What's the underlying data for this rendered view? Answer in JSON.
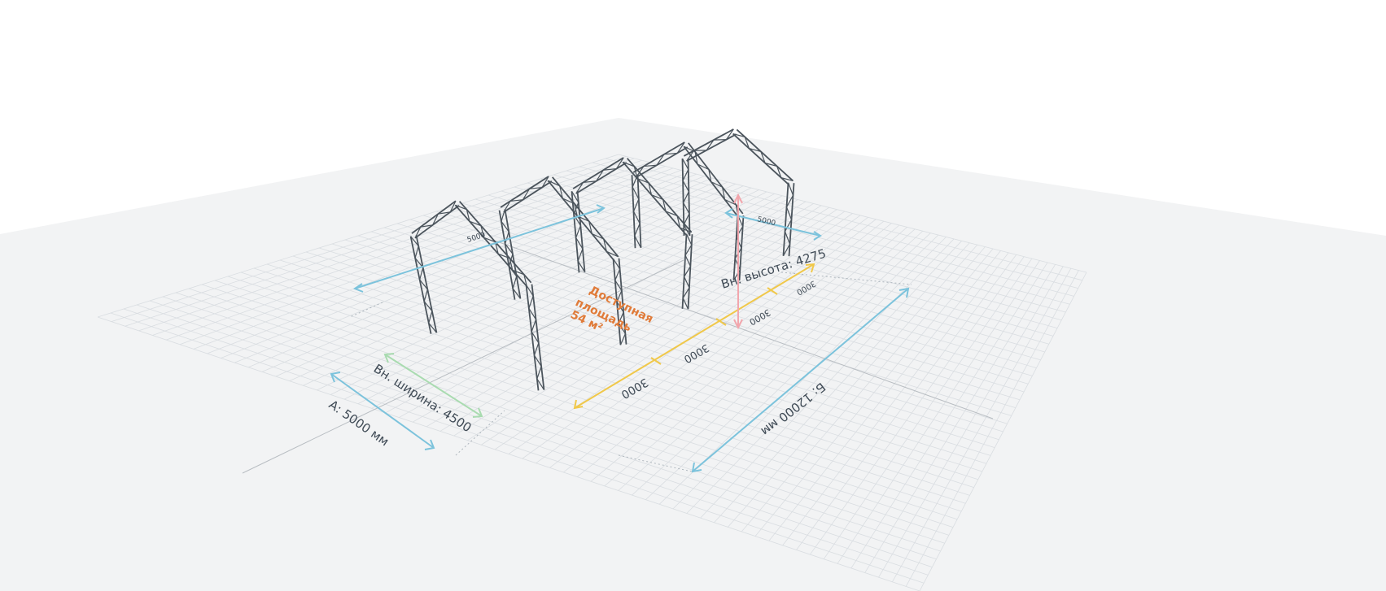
{
  "scene": {
    "floor_color": "#f2f3f4",
    "grid_color": "#d9dde1",
    "axis_color": "#b8bdc2",
    "truss_color": "#4b545c"
  },
  "dimensions": {
    "length_a_label": "А: 5000 мм",
    "length_b_label": "Б: 12000 мм",
    "inner_width_label": "Вн. ширина: 4500",
    "inner_height_label": "Вн. высота: 4275",
    "top_left_label": "5000",
    "top_right_label": "5000",
    "segments": [
      "3000",
      "3000",
      "3000",
      "3000"
    ],
    "colors": {
      "outer": "#7cc3dc",
      "inner_width": "#a9dbb0",
      "segments": "#f0c84a",
      "height": "#f2a6ad"
    }
  },
  "area": {
    "line1": "Доступная",
    "line2": "площадь",
    "line3": "54 м²",
    "color": "#e07b39"
  }
}
